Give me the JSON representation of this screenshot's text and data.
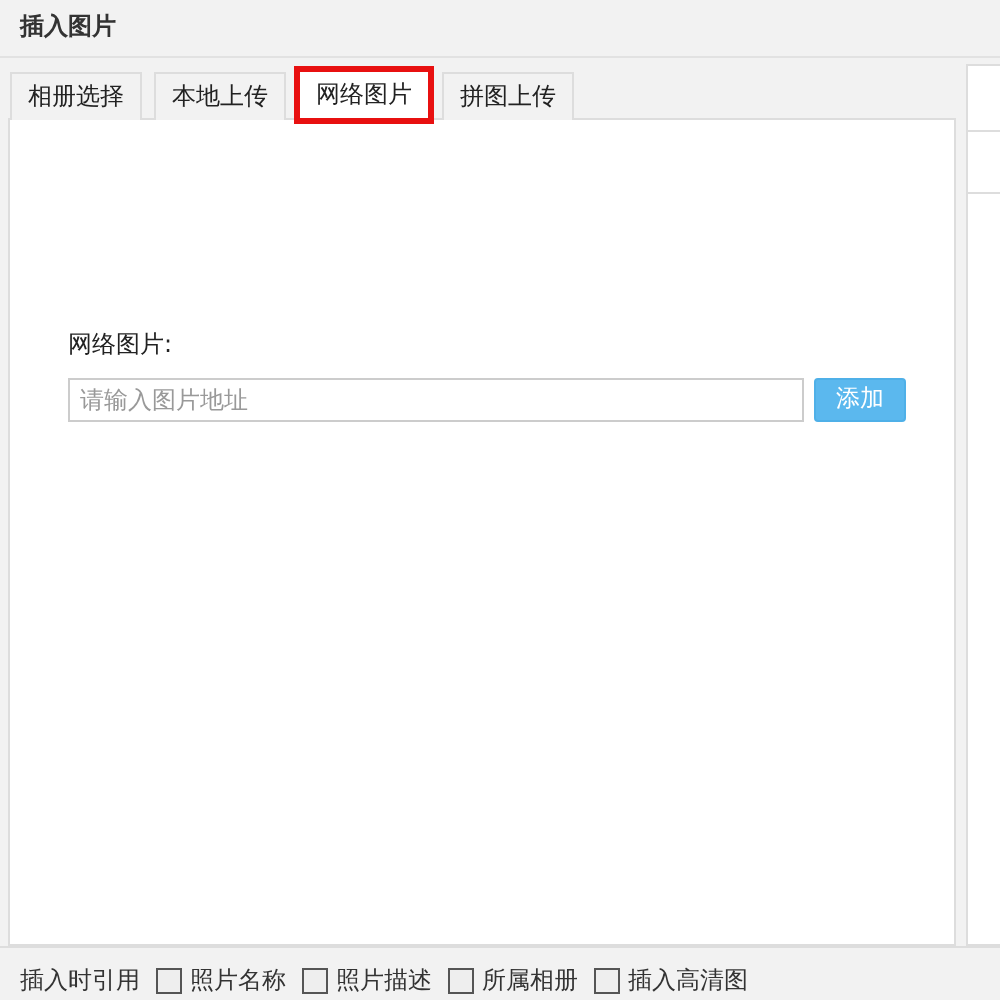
{
  "window": {
    "title": "插入图片"
  },
  "tabs": [
    {
      "label": "相册选择",
      "selected": false,
      "highlighted": false
    },
    {
      "label": "本地上传",
      "selected": false,
      "highlighted": false
    },
    {
      "label": "网络图片",
      "selected": true,
      "highlighted": true
    },
    {
      "label": "拼图上传",
      "selected": false,
      "highlighted": false
    }
  ],
  "url_form": {
    "label": "网络图片:",
    "placeholder": "请输入图片地址",
    "button": "添加"
  },
  "footer": {
    "label": "插入时引用",
    "options": [
      {
        "label": "照片名称",
        "checked": false
      },
      {
        "label": "照片描述",
        "checked": false
      },
      {
        "label": "所属相册",
        "checked": false
      },
      {
        "label": "插入高清图",
        "checked": false
      }
    ]
  }
}
